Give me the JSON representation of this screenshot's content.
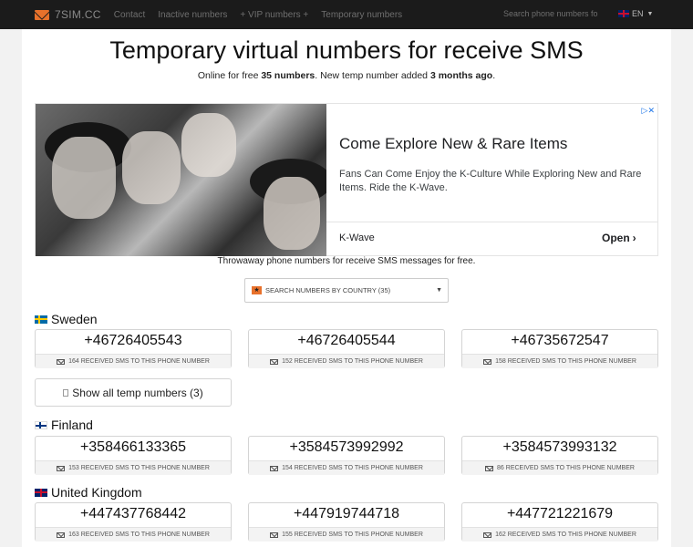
{
  "nav": {
    "brand": "7SIM.CC",
    "links": [
      "Contact",
      "Inactive numbers",
      "+ VIP numbers +",
      "Temporary numbers"
    ],
    "search_placeholder": "Search phone numbers fo",
    "lang": "EN"
  },
  "header": {
    "title": "Temporary virtual numbers for receive SMS",
    "subtitle_prefix": "Online for free ",
    "subtitle_count": "35 numbers",
    "subtitle_mid": ". New temp number added ",
    "subtitle_time": "3 months ago",
    "subtitle_suffix": "."
  },
  "ad": {
    "title": "Come Explore New & Rare Items",
    "description": "Fans Can Come Enjoy the K-Culture While Exploring New and Rare Items. Ride the K-Wave.",
    "brand": "K-Wave",
    "cta": "Open",
    "close": "▷✕"
  },
  "tagline": "Throwaway phone numbers for receive SMS messages for free.",
  "country_select": {
    "label": "SEARCH NUMBERS BY COUNTRY (35)"
  },
  "countries": [
    {
      "name": "Sweden",
      "numbers": [
        {
          "number": "+46726405543",
          "footer": "164 RECEIVED SMS TO THIS PHONE NUMBER"
        },
        {
          "number": "+46726405544",
          "footer": "152 RECEIVED SMS TO THIS PHONE NUMBER"
        },
        {
          "number": "+46735672547",
          "footer": "158 RECEIVED SMS TO THIS PHONE NUMBER"
        }
      ],
      "show_all": "Show all temp numbers (3)"
    },
    {
      "name": "Finland",
      "numbers": [
        {
          "number": "+358466133365",
          "footer": "153 RECEIVED SMS TO THIS PHONE NUMBER"
        },
        {
          "number": "+3584573992992",
          "footer": "154 RECEIVED SMS TO THIS PHONE NUMBER"
        },
        {
          "number": "+3584573993132",
          "footer": "86 RECEIVED SMS TO THIS PHONE NUMBER"
        }
      ]
    },
    {
      "name": "United Kingdom",
      "numbers": [
        {
          "number": "+447437768442",
          "footer": "163 RECEIVED SMS TO THIS PHONE NUMBER"
        },
        {
          "number": "+447919744718",
          "footer": "155 RECEIVED SMS TO THIS PHONE NUMBER"
        },
        {
          "number": "+447721221679",
          "footer": "162 RECEIVED SMS TO THIS PHONE NUMBER"
        }
      ]
    }
  ],
  "colors": {
    "navbar": "#1b1b1b",
    "accent": "#e8712b",
    "page_bg": "#f2f2f2"
  }
}
